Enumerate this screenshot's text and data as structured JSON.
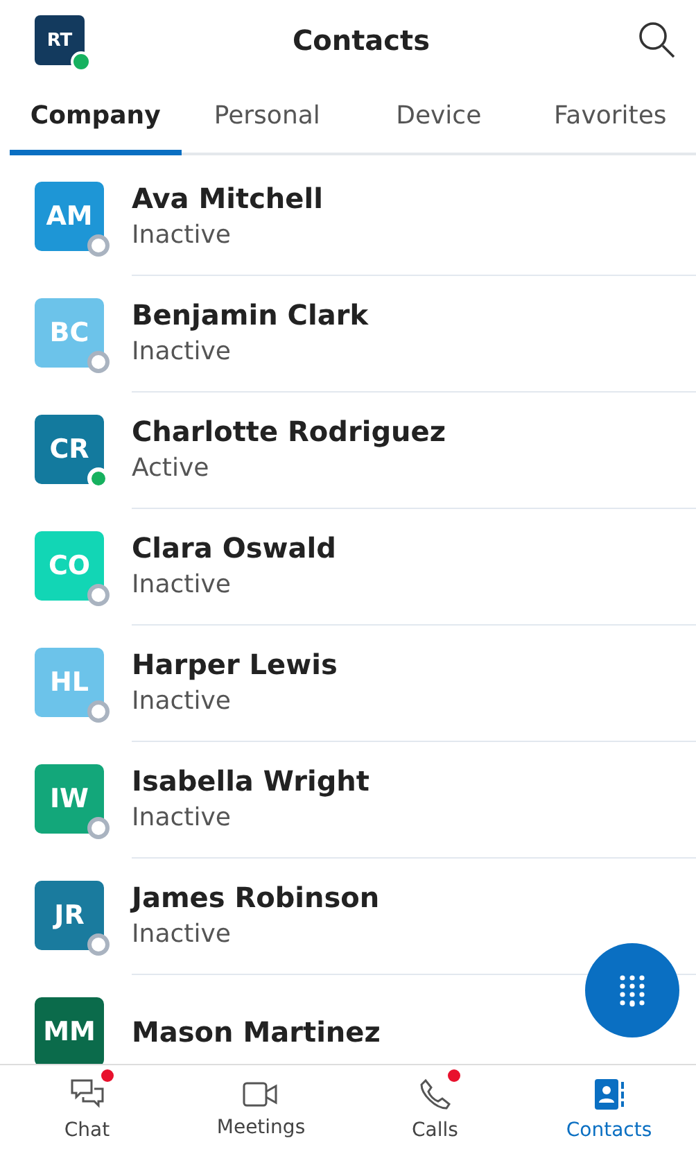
{
  "header": {
    "avatar": "RT",
    "online": true,
    "title": "Contacts"
  },
  "tabs": [
    {
      "label": "Company",
      "selected": true
    },
    {
      "label": "Personal",
      "selected": false
    },
    {
      "label": "Device",
      "selected": false
    },
    {
      "label": "Favorites",
      "selected": false
    }
  ],
  "contacts": [
    {
      "initials": "AM",
      "color": "#1e96d6",
      "name": "Ava Mitchell",
      "status": "Inactive",
      "active": false
    },
    {
      "initials": "BC",
      "color": "#6cc3ea",
      "name": "Benjamin Clark",
      "status": "Inactive",
      "active": false
    },
    {
      "initials": "CR",
      "color": "#137a9e",
      "name": "Charlotte Rodriguez",
      "status": "Active",
      "active": true
    },
    {
      "initials": "CO",
      "color": "#12d6b5",
      "name": "Clara Oswald",
      "status": "Inactive",
      "active": false
    },
    {
      "initials": "HL",
      "color": "#6cc3ea",
      "name": "Harper Lewis",
      "status": "Inactive",
      "active": false
    },
    {
      "initials": "IW",
      "color": "#13a77a",
      "name": "Isabella Wright",
      "status": "Inactive",
      "active": false
    },
    {
      "initials": "JR",
      "color": "#1a7b9e",
      "name": "James Robinson",
      "status": "Inactive",
      "active": false
    },
    {
      "initials": "MM",
      "color": "#0b6b4b",
      "name": "Mason Martinez"
    }
  ],
  "nav": [
    {
      "kind": "chat",
      "label": "Chat",
      "badge": true,
      "selected": false
    },
    {
      "kind": "meetings",
      "label": "Meetings",
      "badge": false,
      "selected": false
    },
    {
      "kind": "calls",
      "label": "Calls",
      "badge": true,
      "selected": false
    },
    {
      "kind": "contacts",
      "label": "Contacts",
      "badge": false,
      "selected": true
    }
  ]
}
